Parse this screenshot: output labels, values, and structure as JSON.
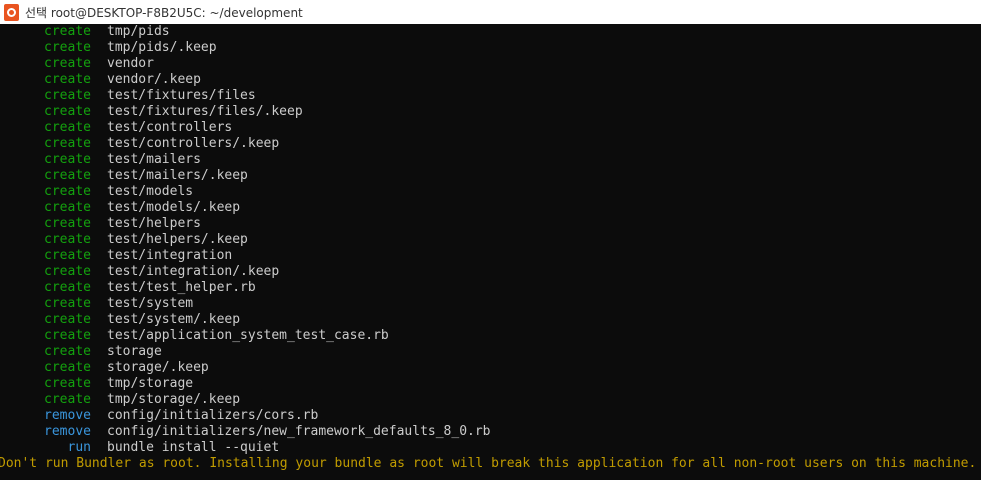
{
  "window": {
    "title_prefix": "선택",
    "title": "root@DESKTOP-F8B2U5C: ~/development",
    "icon": "ubuntu-terminal-icon"
  },
  "terminal": {
    "rows": [
      {
        "verb": "create",
        "path": "tmp/pids"
      },
      {
        "verb": "create",
        "path": "tmp/pids/.keep"
      },
      {
        "verb": "create",
        "path": "vendor"
      },
      {
        "verb": "create",
        "path": "vendor/.keep"
      },
      {
        "verb": "create",
        "path": "test/fixtures/files"
      },
      {
        "verb": "create",
        "path": "test/fixtures/files/.keep"
      },
      {
        "verb": "create",
        "path": "test/controllers"
      },
      {
        "verb": "create",
        "path": "test/controllers/.keep"
      },
      {
        "verb": "create",
        "path": "test/mailers"
      },
      {
        "verb": "create",
        "path": "test/mailers/.keep"
      },
      {
        "verb": "create",
        "path": "test/models"
      },
      {
        "verb": "create",
        "path": "test/models/.keep"
      },
      {
        "verb": "create",
        "path": "test/helpers"
      },
      {
        "verb": "create",
        "path": "test/helpers/.keep"
      },
      {
        "verb": "create",
        "path": "test/integration"
      },
      {
        "verb": "create",
        "path": "test/integration/.keep"
      },
      {
        "verb": "create",
        "path": "test/test_helper.rb"
      },
      {
        "verb": "create",
        "path": "test/system"
      },
      {
        "verb": "create",
        "path": "test/system/.keep"
      },
      {
        "verb": "create",
        "path": "test/application_system_test_case.rb"
      },
      {
        "verb": "create",
        "path": "storage"
      },
      {
        "verb": "create",
        "path": "storage/.keep"
      },
      {
        "verb": "create",
        "path": "tmp/storage"
      },
      {
        "verb": "create",
        "path": "tmp/storage/.keep"
      },
      {
        "verb": "remove",
        "path": "config/initializers/cors.rb"
      },
      {
        "verb": "remove",
        "path": "config/initializers/new_framework_defaults_8_0.rb"
      },
      {
        "verb": "run",
        "path": "bundle install --quiet"
      }
    ],
    "warning": "Don't run Bundler as root. Installing your bundle as root will break this application for all non-root users on this machine."
  },
  "colors": {
    "background": "#0c0c0c",
    "create": "#13a10e",
    "remove": "#3a96dd",
    "run": "#3a96dd",
    "text": "#cccccc",
    "warning": "#c19c00"
  }
}
